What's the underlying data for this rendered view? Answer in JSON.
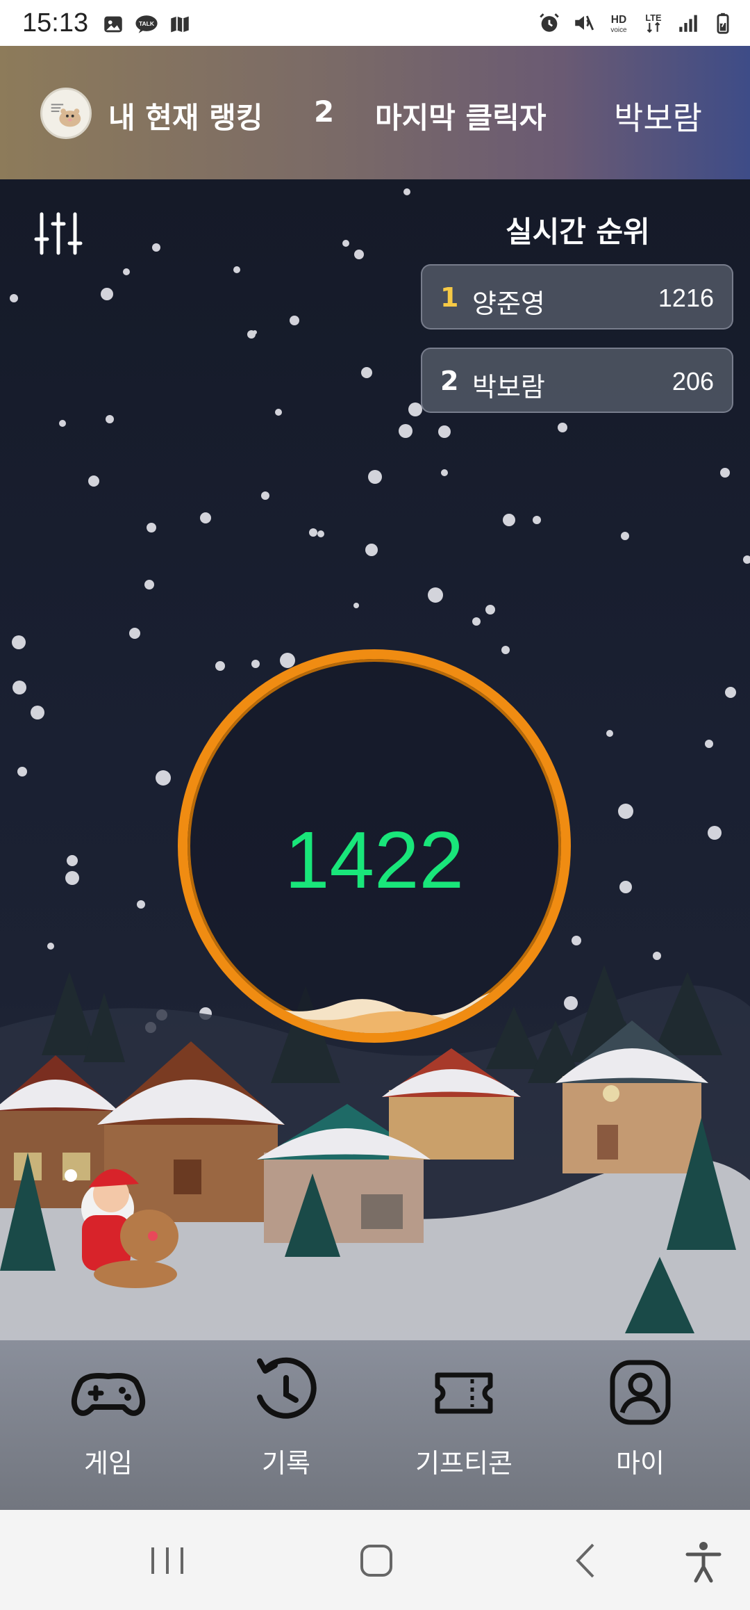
{
  "status_bar": {
    "time": "15:13",
    "left_icons": [
      "image-icon",
      "talk-icon",
      "map-icon"
    ],
    "right_icons": [
      "alarm-icon",
      "mute-icon",
      "hd-voice-icon",
      "lte-icon",
      "signal-icon",
      "battery-icon"
    ],
    "talk_text": "TALK",
    "hd_text": "HD",
    "voice_text": "voice",
    "lte_text": "LTE"
  },
  "header": {
    "avatar_icon": "profile-avatar-hamster",
    "rank_label": "내 현재 랭킹",
    "rank_value": "2",
    "last_clicker_label": "마지막 클릭자",
    "last_clicker_value": "박보람"
  },
  "game": {
    "settings_icon": "sliders-icon",
    "ranking_title": "실시간 순위",
    "ranking": [
      {
        "rank": "1",
        "name": "양준영",
        "score": "1216"
      },
      {
        "rank": "2",
        "name": "박보람",
        "score": "206"
      }
    ],
    "click_count": "1422",
    "ring_color": "#f08c12",
    "count_color": "#19e67a"
  },
  "bottom_nav": {
    "items": [
      {
        "label": "게임",
        "icon": "gamepad-icon"
      },
      {
        "label": "기록",
        "icon": "history-icon"
      },
      {
        "label": "기프티콘",
        "icon": "ticket-icon"
      },
      {
        "label": "마이",
        "icon": "profile-icon"
      }
    ]
  },
  "system_nav": {
    "icons": [
      "recent-apps-icon",
      "home-icon",
      "back-icon",
      "accessibility-icon"
    ]
  }
}
